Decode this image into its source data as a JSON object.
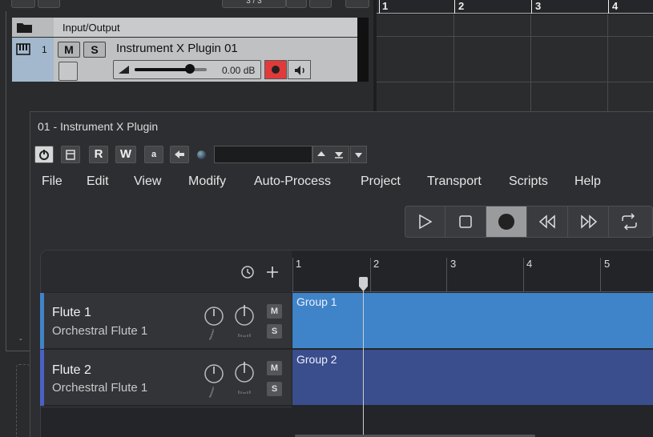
{
  "background_project": {
    "io_label": "Input/Output",
    "counter": "3 / 3",
    "track": {
      "number": "1",
      "mute_label": "M",
      "solo_label": "S",
      "name": "Instrument X Plugin 01",
      "volume_text": "0.00 dB",
      "volume_level": 0.76
    },
    "ruler": [
      "1",
      "2",
      "3",
      "4"
    ],
    "left_marker": "-"
  },
  "plugin_window": {
    "title": "01 - Instrument X Plugin",
    "toolbar": {
      "read_label": "R",
      "write_label": "W",
      "a_label": "a"
    },
    "menu": [
      "File",
      "Edit",
      "View",
      "Modify",
      "Auto-Process",
      "Project",
      "Transport",
      "Scripts",
      "Help"
    ],
    "transport_icons": [
      "play-icon",
      "stop-icon",
      "record-icon",
      "rewind-icon",
      "fast-forward-icon",
      "loop-icon"
    ],
    "ruler": [
      "1",
      "2",
      "3",
      "4",
      "5"
    ],
    "tracks": [
      {
        "name": "Flute 1",
        "instrument": "Orchestral Flute 1",
        "mute": "M",
        "solo": "S",
        "clip": "Group 1",
        "color": "#3f84c8",
        "clip_color": "#3f84c8"
      },
      {
        "name": "Flute 2",
        "instrument": "Orchestral Flute 1",
        "mute": "M",
        "solo": "S",
        "clip": "Group 2",
        "color": "#4a62c4",
        "clip_color": "#3a4d8c"
      }
    ]
  }
}
